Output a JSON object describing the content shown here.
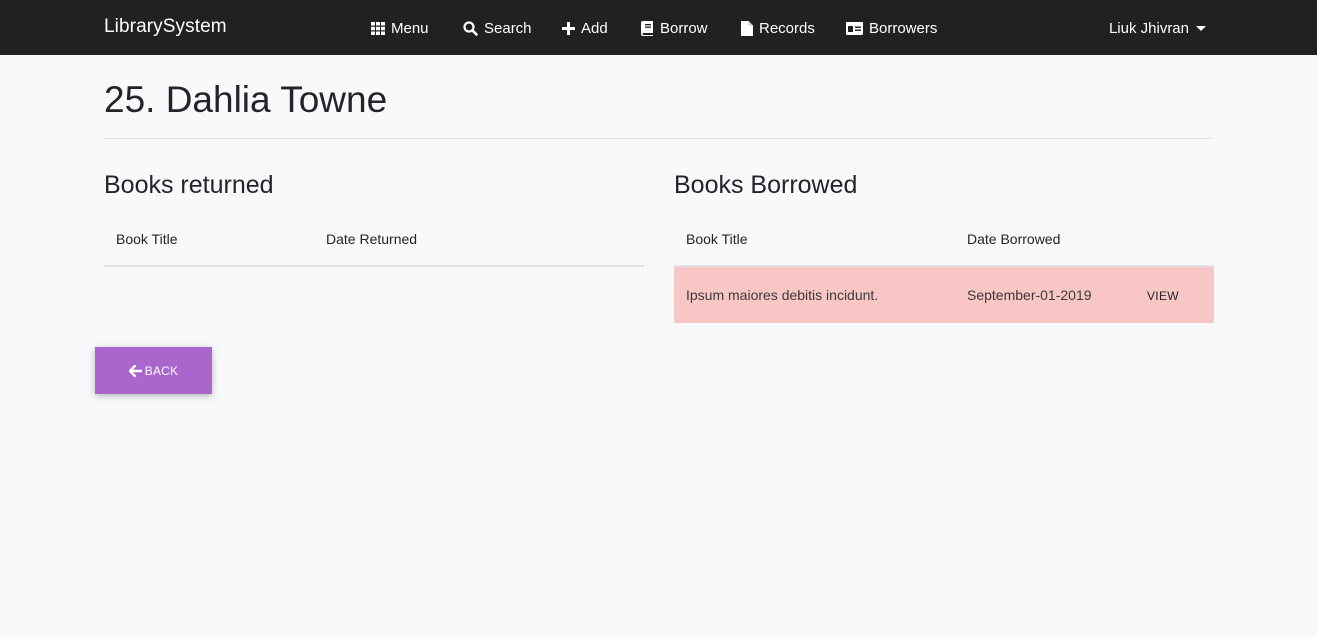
{
  "navbar": {
    "brand": "LibrarySystem",
    "items": [
      {
        "label": "Menu",
        "icon": "grid-icon"
      },
      {
        "label": "Search",
        "icon": "search-icon"
      },
      {
        "label": "Add",
        "icon": "plus-icon"
      },
      {
        "label": "Borrow",
        "icon": "book-icon"
      },
      {
        "label": "Records",
        "icon": "file-icon"
      },
      {
        "label": "Borrowers",
        "icon": "id-card-icon"
      }
    ],
    "user": "Liuk Jhivran"
  },
  "page": {
    "title": "25. Dahlia Towne"
  },
  "returned": {
    "heading": "Books returned",
    "columns": [
      "Book Title",
      "Date Returned"
    ],
    "rows": []
  },
  "borrowed": {
    "heading": "Books Borrowed",
    "columns": [
      "Book Title",
      "Date Borrowed"
    ],
    "rows": [
      {
        "title": "Ipsum maiores debitis incidunt.",
        "date": "September-01-2019",
        "action": "VIEW"
      }
    ]
  },
  "actions": {
    "back_label": "BACK"
  },
  "colors": {
    "navbar": "#212121",
    "back_button": "#aa66cc",
    "row_highlight": "#f8c6c5",
    "background": "#f8f9fb"
  }
}
